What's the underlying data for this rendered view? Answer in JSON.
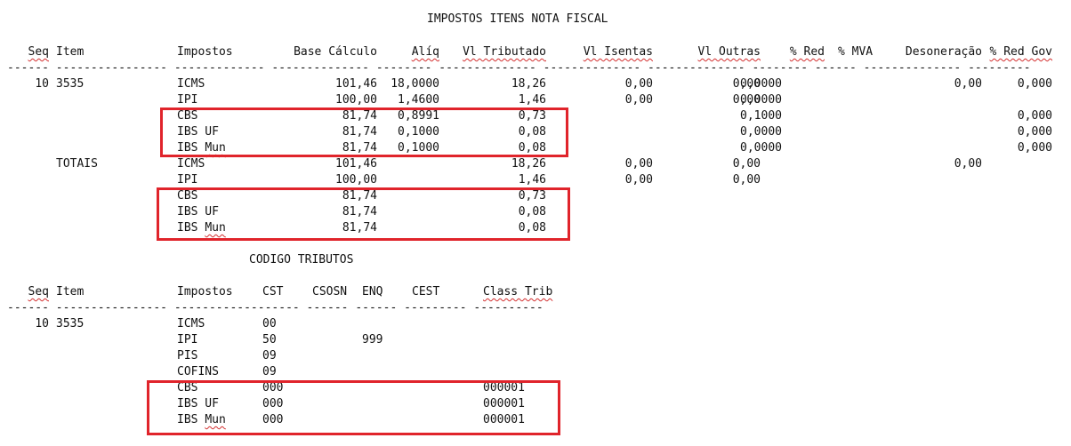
{
  "report": {
    "title": "IMPOSTOS ITENS NOTA FISCAL",
    "headers": {
      "seq": "Seq",
      "item": "Item",
      "impostos": "Impostos",
      "base": "Base Cálculo",
      "aliq": "Alíq",
      "vl_trib": "Vl Tributado",
      "vl_isentas": "Vl Isentas",
      "vl_outras": "Vl Outras",
      "red": "% Red",
      "mva": "% MVA",
      "desoneracao": "Desoneração",
      "red_gov": "% Red Gov"
    },
    "separator": "------ ---------------- ------------- -------------- -------- -------------- -------------- -------------- -------- ------ -------------- ---------",
    "rows": [
      {
        "seq": "10",
        "item": "3535",
        "imp": "ICMS",
        "base": "101,46",
        "aliq": "18,0000",
        "vt": "18,26",
        "vi": "0,00",
        "vo": "0,00",
        "red": "0,0000",
        "des": "0,00",
        "rg": "0,000"
      },
      {
        "seq": "",
        "item": "",
        "imp": "IPI",
        "base": "100,00",
        "aliq": "1,4600",
        "vt": "1,46",
        "vi": "0,00",
        "vo": "0,00",
        "red": "0,0000",
        "des": "",
        "rg": ""
      },
      {
        "seq": "",
        "item": "",
        "imp": "CBS",
        "base": "81,74",
        "aliq": "0,8991",
        "vt": "0,73",
        "vi": "",
        "vo": "",
        "red": "0,1000",
        "des": "",
        "rg": "0,000"
      },
      {
        "seq": "",
        "item": "",
        "imp": "IBS UF",
        "base": "81,74",
        "aliq": "0,1000",
        "vt": "0,08",
        "vi": "",
        "vo": "",
        "red": "0,0000",
        "des": "",
        "rg": "0,000"
      },
      {
        "seq": "",
        "item": "",
        "imp": "IBS Mun",
        "base": "81,74",
        "aliq": "0,1000",
        "vt": "0,08",
        "vi": "",
        "vo": "",
        "red": "0,0000",
        "des": "",
        "rg": "0,000"
      },
      {
        "seq": "",
        "item": "TOTAIS",
        "imp": "ICMS",
        "base": "101,46",
        "aliq": "",
        "vt": "18,26",
        "vi": "0,00",
        "vo": "0,00",
        "red": "",
        "des": "0,00",
        "rg": ""
      },
      {
        "seq": "",
        "item": "",
        "imp": "IPI",
        "base": "100,00",
        "aliq": "",
        "vt": "1,46",
        "vi": "0,00",
        "vo": "0,00",
        "red": "",
        "des": "",
        "rg": ""
      },
      {
        "seq": "",
        "item": "",
        "imp": "CBS",
        "base": "81,74",
        "aliq": "",
        "vt": "0,73",
        "vi": "",
        "vo": "",
        "red": "",
        "des": "",
        "rg": ""
      },
      {
        "seq": "",
        "item": "",
        "imp": "IBS UF",
        "base": "81,74",
        "aliq": "",
        "vt": "0,08",
        "vi": "",
        "vo": "",
        "red": "",
        "des": "",
        "rg": ""
      },
      {
        "seq": "",
        "item": "",
        "imp": "IBS Mun",
        "base": "81,74",
        "aliq": "",
        "vt": "0,08",
        "vi": "",
        "vo": "",
        "red": "",
        "des": "",
        "rg": ""
      }
    ]
  },
  "codigo": {
    "title": "CODIGO TRIBUTOS",
    "headers": {
      "seq": "Seq",
      "item": "Item",
      "impostos": "Impostos",
      "cst": "CST",
      "csosn": "CSOSN",
      "enq": "ENQ",
      "cest": "CEST",
      "class_trib": "Class Trib"
    },
    "separator": "------ ---------------- ------------------ ------ ------ --------- ----------",
    "rows": [
      {
        "seq": "10",
        "item": "3535",
        "imp": "ICMS",
        "cst": "00",
        "enq": "",
        "ct": ""
      },
      {
        "seq": "",
        "item": "",
        "imp": "IPI",
        "cst": "50",
        "enq": "999",
        "ct": ""
      },
      {
        "seq": "",
        "item": "",
        "imp": "PIS",
        "cst": "09",
        "enq": "",
        "ct": ""
      },
      {
        "seq": "",
        "item": "",
        "imp": "COFINS",
        "cst": "09",
        "enq": "",
        "ct": ""
      },
      {
        "seq": "",
        "item": "",
        "imp": "CBS",
        "cst": "000",
        "enq": "",
        "ct": "000001"
      },
      {
        "seq": "",
        "item": "",
        "imp": "IBS UF",
        "cst": "000",
        "enq": "",
        "ct": "000001"
      },
      {
        "seq": "",
        "item": "",
        "imp": "IBS Mun",
        "cst": "000",
        "enq": "",
        "ct": "000001"
      }
    ]
  },
  "colors": {
    "highlight": "#e0242b",
    "spellcheck": "#d32f2f"
  }
}
